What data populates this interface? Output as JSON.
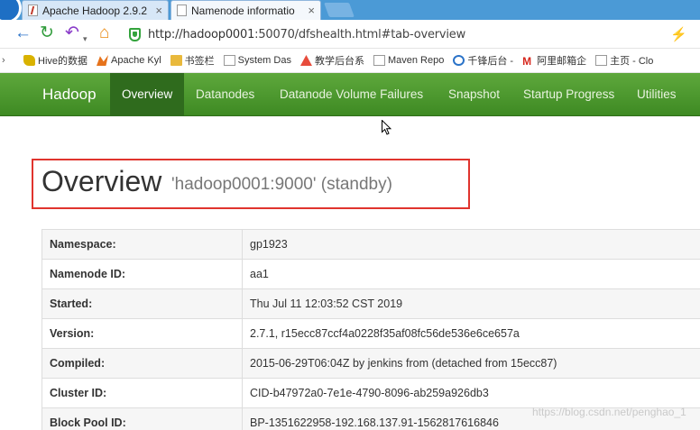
{
  "browser": {
    "tabs": [
      {
        "label": "Apache Hadoop 2.9.2",
        "close": "×"
      },
      {
        "label": "Namenode informatio",
        "close": "×"
      }
    ],
    "url_prefix": "http://",
    "url_host": "hadoop0001",
    "url_rest": ":50070/dfshealth.html#tab-overview",
    "bookmarks": [
      {
        "label": "Hive的数据",
        "icon": "hive-icon"
      },
      {
        "label": "Apache Kyl",
        "icon": "kylin-icon"
      },
      {
        "label": "书签栏",
        "icon": "folder-icon"
      },
      {
        "label": "System Das",
        "icon": "page-icon"
      },
      {
        "label": "教学后台系",
        "icon": "edu-icon"
      },
      {
        "label": "Maven Repo",
        "icon": "page-icon"
      },
      {
        "label": "千锋后台 -",
        "icon": "q-icon"
      },
      {
        "label": "阿里邮箱企",
        "icon": "mail-icon"
      },
      {
        "label": "主页 - Clo",
        "icon": "page-icon"
      }
    ]
  },
  "navbar": {
    "brand": "Hadoop",
    "items": [
      "Overview",
      "Datanodes",
      "Datanode Volume Failures",
      "Snapshot",
      "Startup Progress",
      "Utilities"
    ]
  },
  "overview": {
    "title": "Overview",
    "subtitle": "'hadoop0001:9000' (standby)"
  },
  "info_rows": [
    {
      "key": "Namespace:",
      "value": "gp1923"
    },
    {
      "key": "Namenode ID:",
      "value": "aa1"
    },
    {
      "key": "Started:",
      "value": "Thu Jul 11 12:03:52 CST 2019"
    },
    {
      "key": "Version:",
      "value": "2.7.1, r15ecc87ccf4a0228f35af08fc56de536e6ce657a"
    },
    {
      "key": "Compiled:",
      "value": "2015-06-29T06:04Z by jenkins from (detached from 15ecc87)"
    },
    {
      "key": "Cluster ID:",
      "value": "CID-b47972a0-7e1e-4790-8096-ab259a926db3"
    },
    {
      "key": "Block Pool ID:",
      "value": "BP-1351622958-192.168.137.91-1562817616846"
    }
  ],
  "watermark": "https://blog.csdn.net/penghao_1",
  "colors": {
    "navbar": "#4a9a2c",
    "highlight_box": "#e0342e"
  }
}
